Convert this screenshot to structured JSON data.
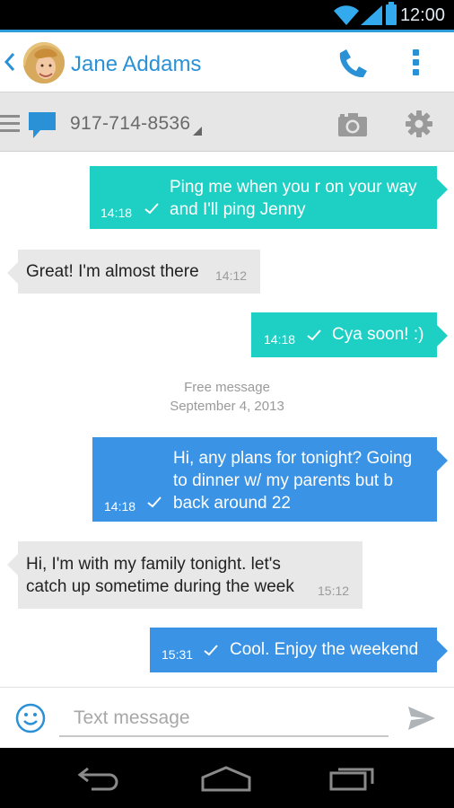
{
  "status_bar": {
    "time": "12:00"
  },
  "header": {
    "contact_name": "Jane Addams"
  },
  "recipient": {
    "number": "917-714-8536"
  },
  "messages": [
    {
      "direction": "outgoing",
      "color": "#1ecfc4",
      "lines": [
        "Ping me when you r on your way",
        "and I'll ping Jenny"
      ],
      "time": "14:18",
      "status": "sent"
    },
    {
      "direction": "incoming",
      "lines": [
        "Great! I'm almost there"
      ],
      "time": "14:12"
    },
    {
      "direction": "outgoing",
      "color": "#1ecfc4",
      "lines": [
        "Cya soon! :)"
      ],
      "time": "14:18",
      "status": "sent"
    },
    {
      "direction": "outgoing",
      "color": "#3a93e4",
      "lines": [
        "Hi, any plans for tonight? Going",
        "to dinner w/ my parents but b",
        "back around 22"
      ],
      "time": "14:18",
      "status": "sent"
    },
    {
      "direction": "incoming",
      "lines": [
        "Hi, I'm with my family tonight. let's",
        "catch up sometime during the week"
      ],
      "time": "15:12"
    },
    {
      "direction": "outgoing",
      "color": "#3a93e4",
      "lines": [
        "Cool. Enjoy the weekend"
      ],
      "time": "15:31",
      "status": "sent"
    }
  ],
  "separator": {
    "label": "Free message",
    "date": "September 4, 2013"
  },
  "compose": {
    "placeholder": "Text message",
    "value": ""
  },
  "icons": {
    "status": [
      "wifi-icon",
      "signal-icon",
      "battery-icon"
    ],
    "header": [
      "back-icon",
      "avatar",
      "phone-icon",
      "overflow-menu-icon"
    ],
    "recipient_bar": [
      "menu-icon",
      "sms-icon",
      "dropdown-icon",
      "camera-icon",
      "gear-icon"
    ],
    "compose": [
      "emoji-icon",
      "send-icon"
    ],
    "nav": [
      "nav-back-icon",
      "nav-home-icon",
      "nav-recent-apps-icon"
    ]
  },
  "colors": {
    "accent": "#2b91d6",
    "outgoing_teal": "#1ecfc4",
    "outgoing_blue": "#3a93e4",
    "incoming": "#e8e8e8"
  }
}
